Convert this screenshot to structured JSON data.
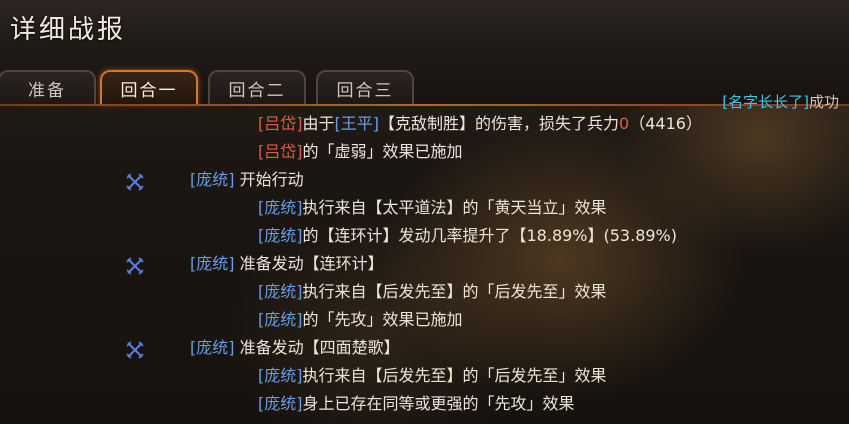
{
  "title": "详细战报",
  "tabs": [
    {
      "label": "准备"
    },
    {
      "label": "回合一"
    },
    {
      "label": "回合二"
    },
    {
      "label": "回合三"
    }
  ],
  "result_banner": {
    "name": "[名字长长了]",
    "text": "成功"
  },
  "log": {
    "l1": {
      "a": "[吕岱]",
      "b": "由于",
      "c": "[王平]",
      "d": "【克敌制胜】的伤害，损失了兵力",
      "e": "0",
      "f": "（4416）"
    },
    "l2": {
      "a": "[吕岱]",
      "b": "的「虚弱」效果已施加"
    },
    "l3": {
      "name": "[庞统]",
      "text": "开始行动"
    },
    "l4": {
      "a": "[庞统]",
      "b": "执行来自【太平道法】的「黄天当立」效果"
    },
    "l5": {
      "a": "[庞统]",
      "b": "的【连环计】发动几率提升了【18.89%】(53.89%)"
    },
    "l6": {
      "name": "[庞统]",
      "text": "准备发动【连环计】"
    },
    "l7": {
      "a": "[庞统]",
      "b": "执行来自【后发先至】的「后发先至」效果"
    },
    "l8": {
      "a": "[庞统]",
      "b": "的「先攻」效果已施加"
    },
    "l9": {
      "name": "[庞统]",
      "text": "准备发动【四面楚歌】"
    },
    "l10": {
      "a": "[庞统]",
      "b": "执行来自【后发先至】的「后发先至」效果"
    },
    "l11": {
      "a": "[庞统]",
      "b": "身上已存在同等或更强的「先攻」效果"
    }
  },
  "icons": {
    "action": "crossed-swords-icon"
  },
  "colors": {
    "accent": "#d8752b",
    "enemy_name": "#e05a4e",
    "ally_name": "#6a9de6",
    "highlight": "#3fc6e6"
  }
}
